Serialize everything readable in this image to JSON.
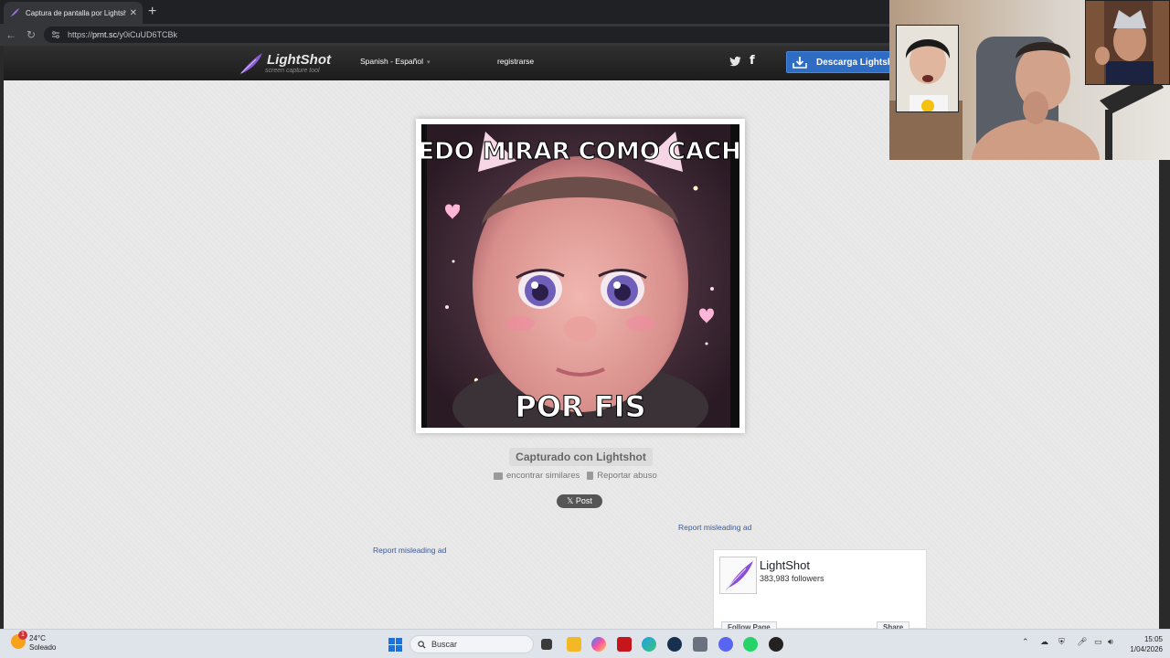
{
  "browser": {
    "tab_title": "Captura de pantalla por Lightshot",
    "url_scheme": "https://",
    "url_host": "prnt.sc",
    "url_path": "/y0iCuUD6TCBk"
  },
  "site": {
    "logo_name": "LightShot",
    "logo_sub": "screen capture tool",
    "language": "Spanish - Español",
    "register": "registrarse",
    "download": "Descarga Lightshot"
  },
  "screenshot": {
    "top_caption": "PUEDO MIRAR COMO CACHAN",
    "bottom_caption": "POR FIS"
  },
  "captured_label": "Capturado con Lightshot",
  "links": {
    "similar": "encontrar similares",
    "report": "Reportar abuso"
  },
  "post_button": "𝕏 Post",
  "ads": {
    "report_1": "Report misleading ad",
    "report_2": "Report misleading ad"
  },
  "facebook": {
    "page_name": "LightShot",
    "followers": "383,983 followers",
    "follow": "Follow Page",
    "share": "Share"
  },
  "taskbar": {
    "temperature": "24°C",
    "condition": "Soleado",
    "weather_badge": "1",
    "search_placeholder": "Buscar",
    "time": "15:05",
    "date": "1/04/2026"
  }
}
